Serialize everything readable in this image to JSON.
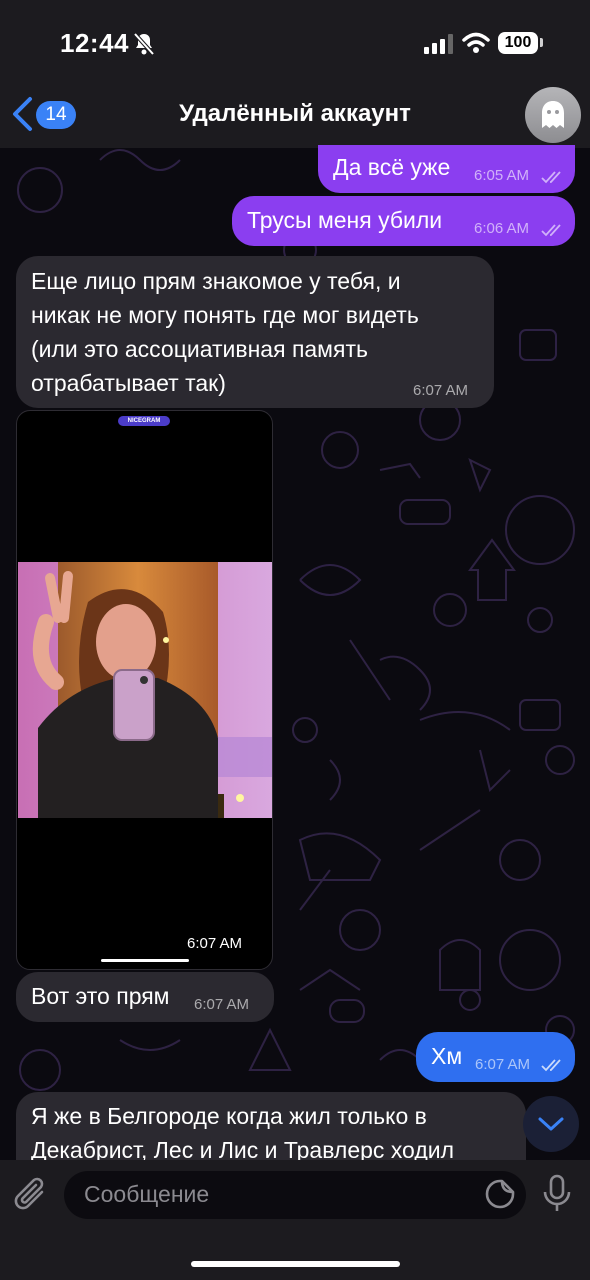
{
  "status_bar": {
    "time": "12:44",
    "battery": "100"
  },
  "header": {
    "back_count": "14",
    "title": "Удалённый аккаунт"
  },
  "messages": [
    {
      "text": "Да всё уже",
      "time": "6:05 AM"
    },
    {
      "text": "Трусы меня убили",
      "time": "6:06 AM"
    },
    {
      "lines": [
        "Еще лицо прям знакомое у тебя, и",
        "никак не могу понять где мог видеть",
        "(или это ассоциативная память",
        "отрабатывает так)"
      ],
      "time": "6:07 AM"
    },
    {
      "badge": "NICEGRAM",
      "time": "6:07 AM"
    },
    {
      "text": "Вот это прям",
      "time": "6:07 AM"
    },
    {
      "text": "Хм",
      "time": "6:07 AM"
    },
    {
      "lines": [
        "Я же в Белгороде когда жил только в",
        "Декабрист, Лес и Лис и Травлерс ходил"
      ]
    }
  ],
  "input": {
    "placeholder": "Сообщение"
  },
  "colors": {
    "outgoing_purple": "#8b3ef0",
    "outgoing_blue": "#2f6ff0",
    "incoming": "#2b2930",
    "accent": "#3a82f6"
  },
  "icons": [
    "bell-slash-icon",
    "signal-icon",
    "wifi-icon",
    "back-chevron-icon",
    "ghost-icon",
    "double-check-icon",
    "chevron-down-icon",
    "paperclip-icon",
    "sticker-icon",
    "microphone-icon"
  ]
}
